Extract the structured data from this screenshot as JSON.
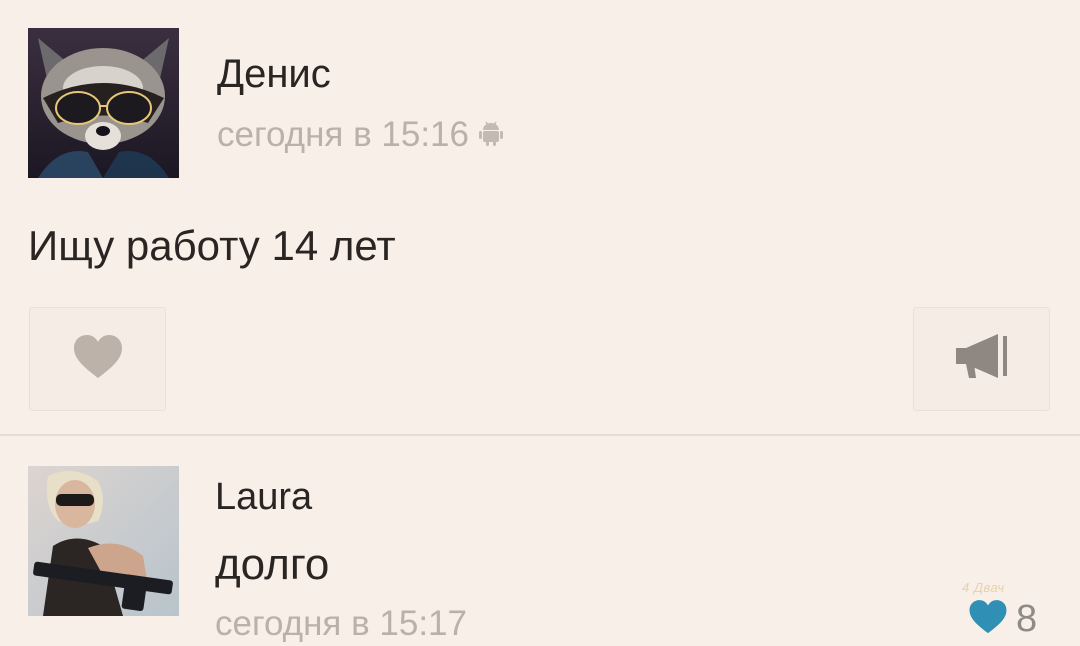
{
  "post": {
    "author": "Денис",
    "time": "сегодня в 15:16",
    "platform_icon": "android-icon",
    "text": "Ищу работу 14 лет",
    "like_icon": "heart-icon",
    "share_icon": "megaphone-icon"
  },
  "comment": {
    "author": "Laura",
    "text": "долго",
    "time": "сегодня в 15:17",
    "likes_icon": "heart-icon",
    "likes_count": "8"
  },
  "watermark": "4 Двач",
  "colors": {
    "background": "#f7efe8",
    "meta_text": "#b9b1aa",
    "button_icon": "#bcb2aa",
    "liked_heart": "#2f8fb4"
  }
}
